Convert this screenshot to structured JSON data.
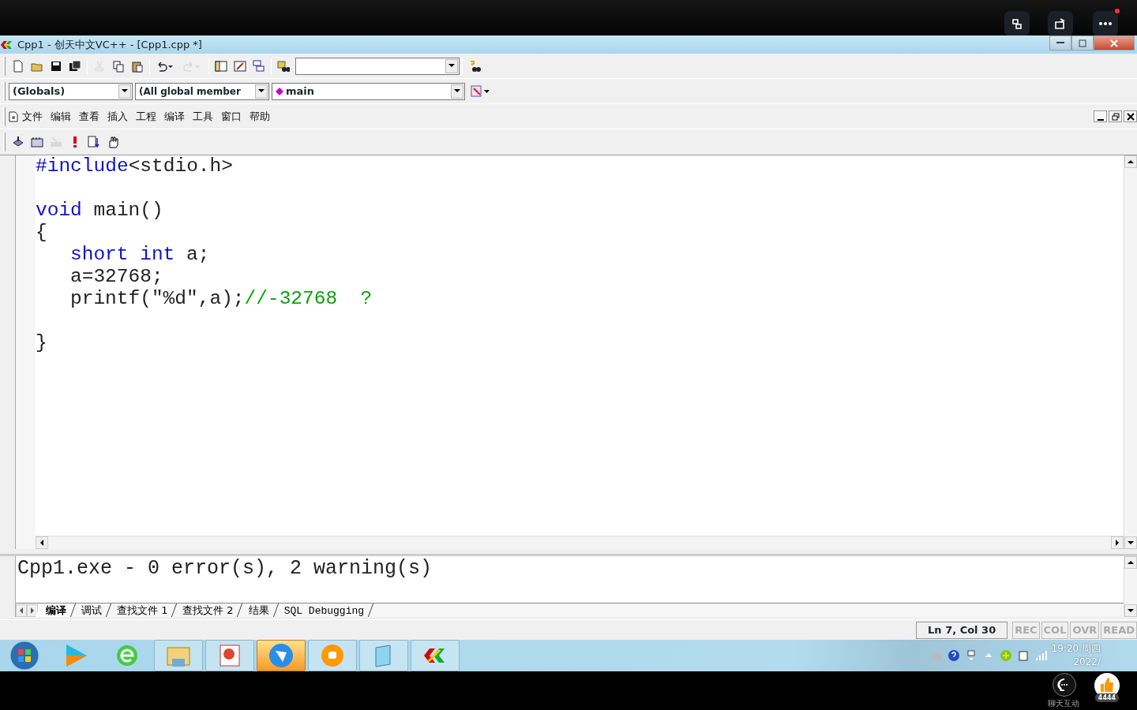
{
  "player": {
    "notification": true
  },
  "window": {
    "title": "Cpp1 - 创天中文VC++ - [Cpp1.cpp *]"
  },
  "standard_toolbar": [
    {
      "disabled": false
    },
    {
      "disabled": false
    },
    {
      "disabled": false
    },
    {
      "disabled": false
    },
    {
      "disabled": true
    },
    {
      "disabled": false
    },
    {
      "disabled": false
    },
    {
      "disabled": false
    },
    {
      "disabled": true
    },
    {
      "disabled": false
    },
    {
      "disabled": false
    },
    {
      "disabled": false
    },
    {
      "disabled": false
    },
    {
      "disabled": false
    }
  ],
  "wizard_bar": {
    "scope": "(Globals)",
    "filter": "(All global member",
    "member": "main"
  },
  "menu": [
    "文件",
    "编辑",
    "查看",
    "插入",
    "工程",
    "编译",
    "工具",
    "窗口",
    "帮助"
  ],
  "build_toolbar": [
    {
      "disabled": false
    },
    {
      "disabled": false
    },
    {
      "disabled": true
    },
    {
      "disabled": false
    },
    {
      "disabled": false
    },
    {
      "disabled": false
    }
  ],
  "editor": {
    "lines": [
      {
        "kind": "code",
        "tokens": [
          {
            "text": "#include",
            "kind": "keyword"
          },
          {
            "text": "<stdio.h>",
            "kind": "plain"
          }
        ]
      },
      {
        "kind": "blank"
      },
      {
        "kind": "code",
        "tokens": [
          {
            "text": "void",
            "kind": "keyword"
          },
          {
            "text": " main()",
            "kind": "plain"
          }
        ]
      },
      {
        "kind": "code",
        "tokens": [
          {
            "text": "{",
            "kind": "plain"
          }
        ],
        "children": [
          {
            "kind": "code",
            "tokens": [
              {
                "text": "short int",
                "kind": "keyword"
              },
              {
                "text": " a;",
                "kind": "plain"
              }
            ]
          },
          {
            "kind": "code",
            "tokens": [
              {
                "text": "a=32768;",
                "kind": "plain"
              }
            ]
          },
          {
            "kind": "code",
            "tokens": [
              {
                "text": "printf(\"%d\",a);",
                "kind": "plain"
              },
              {
                "text": "//-32768  ?",
                "kind": "comment"
              }
            ]
          },
          {
            "kind": "blank"
          }
        ]
      },
      {
        "kind": "code",
        "tokens": [
          {
            "text": "}",
            "kind": "plain"
          }
        ]
      }
    ]
  },
  "output": {
    "text": "Cpp1.exe - 0 error(s), 2 warning(s)",
    "tabs": [
      {
        "label": "编译",
        "selected": true
      },
      {
        "label": "调试",
        "selected": false
      },
      {
        "label": "查找文件 1",
        "selected": false
      },
      {
        "label": "查找文件 2",
        "selected": false
      },
      {
        "label": "结果",
        "selected": false
      },
      {
        "label": "SQL Debugging",
        "selected": false
      }
    ]
  },
  "status_bar": {
    "position": "Ln 7, Col 30",
    "indicators": [
      {
        "label": "REC",
        "on": false
      },
      {
        "label": "COL",
        "on": false
      },
      {
        "label": "OVR",
        "on": false
      },
      {
        "label": "READ",
        "on": false
      }
    ]
  },
  "taskbar": {
    "apps": [
      {
        "running": false,
        "active": false
      },
      {
        "running": false,
        "active": false
      },
      {
        "running": true,
        "active": false
      },
      {
        "running": true,
        "active": false
      },
      {
        "running": true,
        "active": true
      },
      {
        "running": true,
        "active": false
      },
      {
        "running": true,
        "active": false
      },
      {
        "running": true,
        "active": false
      }
    ],
    "clock": {
      "time": "19:20 周四",
      "date": "2022/"
    }
  },
  "overlay": {
    "chat_label": "聊天互动",
    "likes": "4444"
  }
}
